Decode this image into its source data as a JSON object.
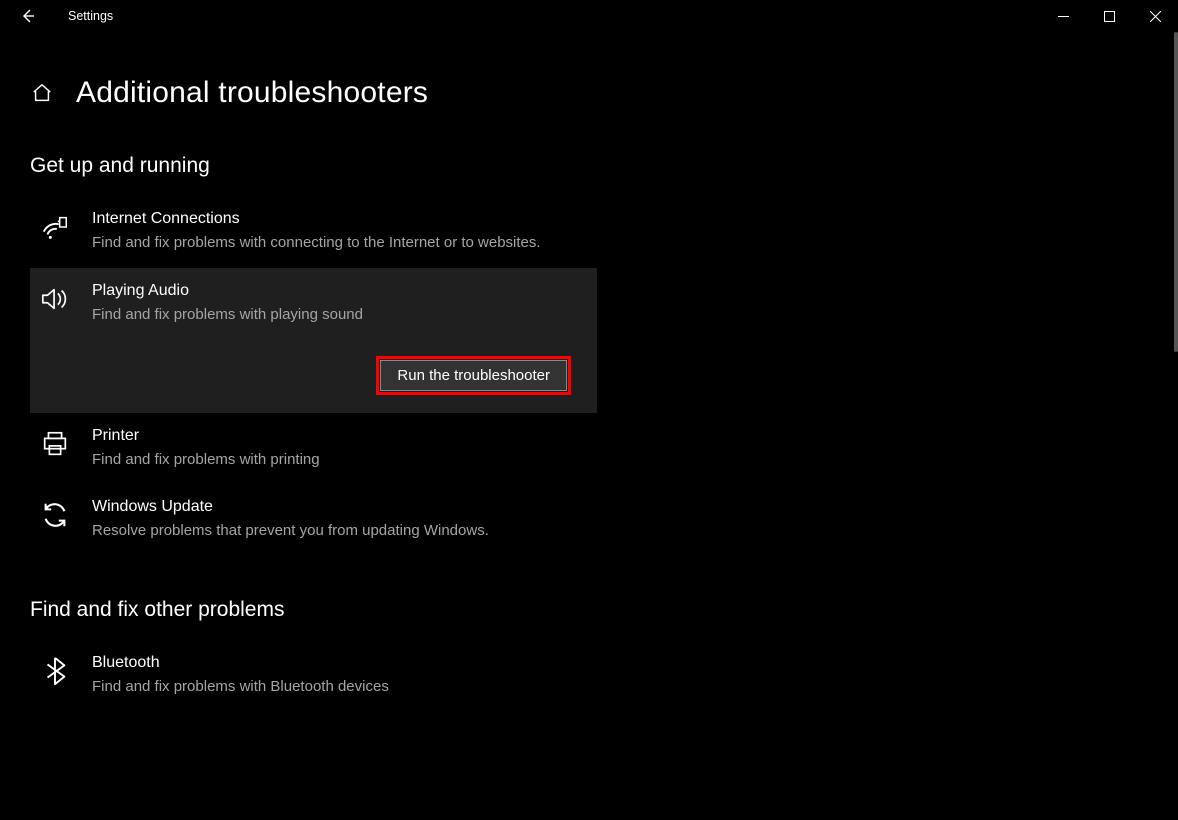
{
  "titlebar": {
    "app_title": "Settings"
  },
  "header": {
    "page_title": "Additional troubleshooters"
  },
  "sections": {
    "s1": {
      "heading": "Get up and running",
      "items": {
        "internet": {
          "title": "Internet Connections",
          "desc": "Find and fix problems with connecting to the Internet or to websites."
        },
        "audio": {
          "title": "Playing Audio",
          "desc": "Find and fix problems with playing sound",
          "run_label": "Run the troubleshooter"
        },
        "printer": {
          "title": "Printer",
          "desc": "Find and fix problems with printing"
        },
        "update": {
          "title": "Windows Update",
          "desc": "Resolve problems that prevent you from updating Windows."
        }
      }
    },
    "s2": {
      "heading": "Find and fix other problems",
      "items": {
        "bluetooth": {
          "title": "Bluetooth",
          "desc": "Find and fix problems with Bluetooth devices"
        }
      }
    }
  }
}
